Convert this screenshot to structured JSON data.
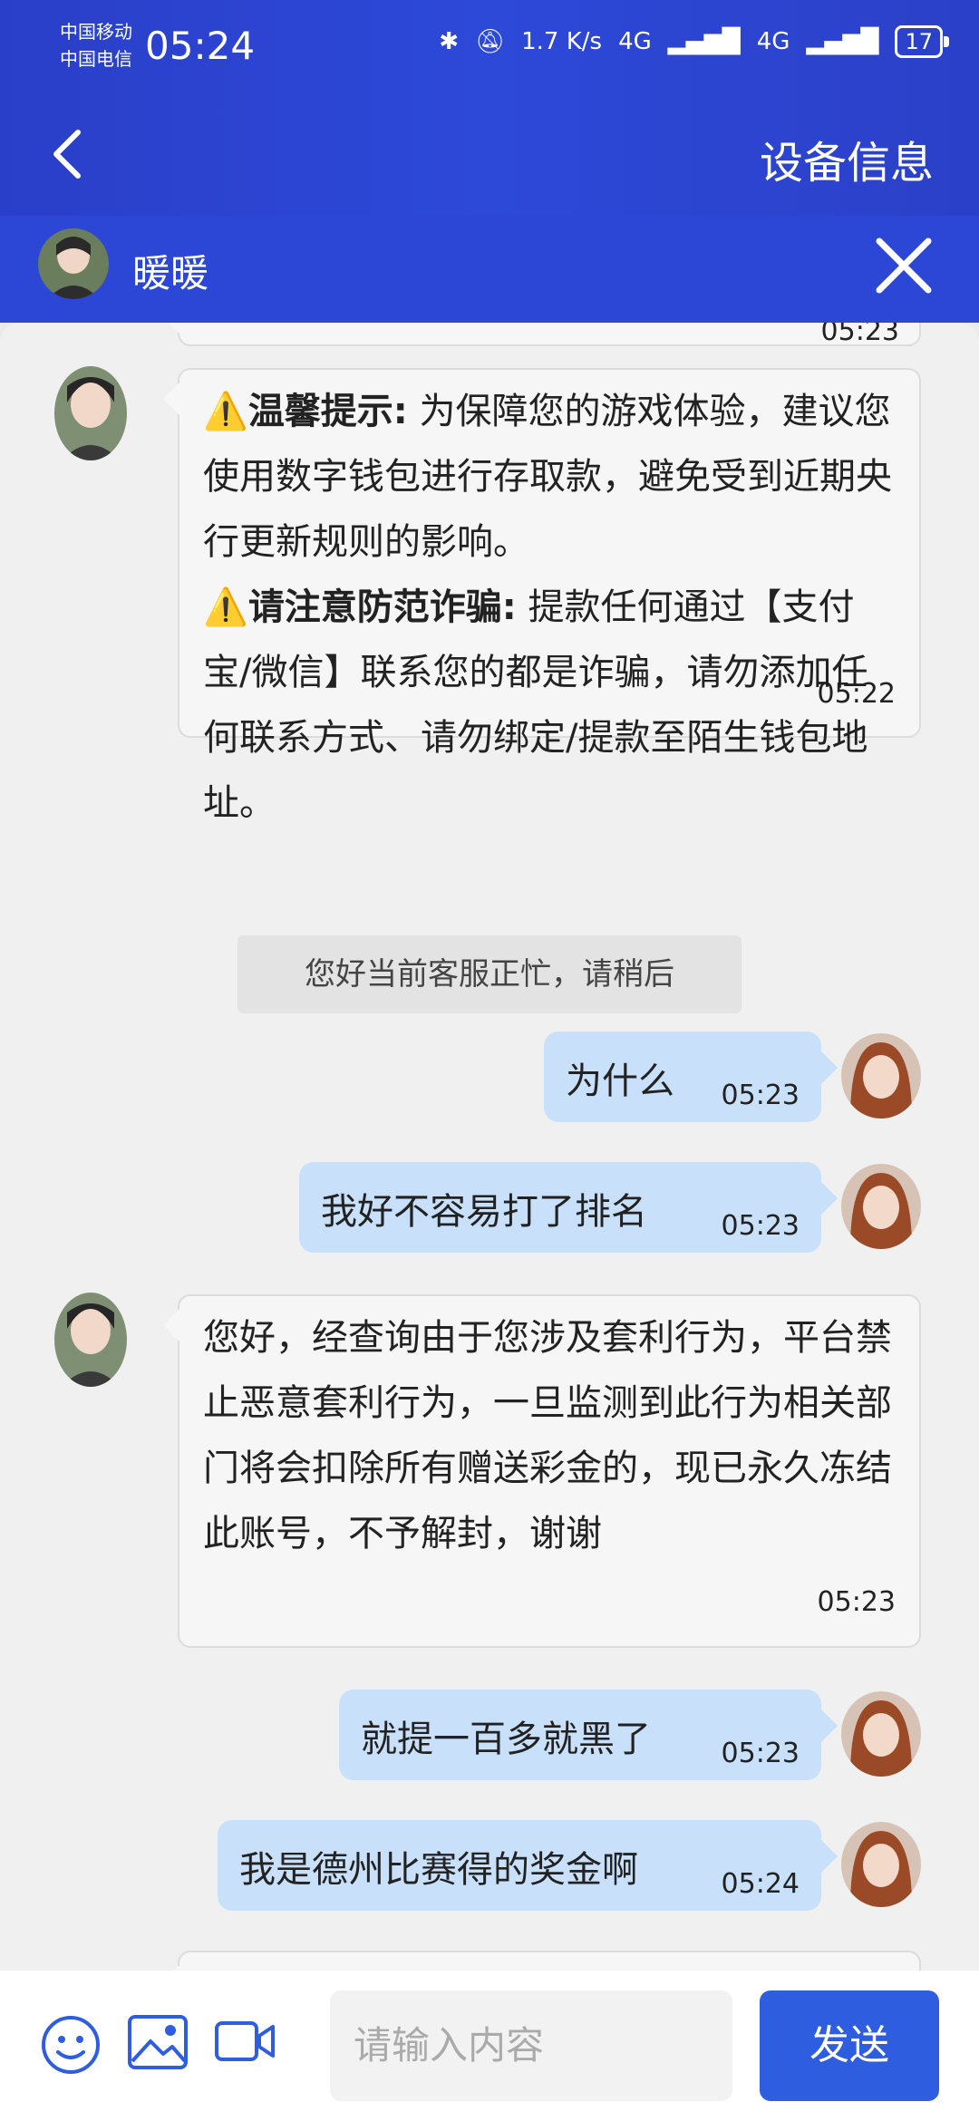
{
  "status_bar": {
    "carrier1": "中国移动",
    "carrier2": "中国电信",
    "time": "05:24",
    "net_speed": "1.7 K/s",
    "signal1": "4G",
    "signal2": "4G",
    "battery": "17"
  },
  "header": {
    "title": "设备信息"
  },
  "chat_header": {
    "name": "暖暖"
  },
  "messages": [
    {
      "from": "agent",
      "title1": "温馨提示:",
      "text1": "为保障您的游戏体验，建议您使用数字钱包进行存取款，避免受到近期央行更新规则的影响。",
      "title2": "请注意防范诈骗:",
      "text2": "提款任何通过【支付宝/微信】联系您的都是诈骗，请勿添加任何联系方式、请勿绑定/提款至陌生钱包地址。",
      "time": "05:22"
    },
    {
      "from": "system",
      "text": "您好当前客服正忙，请稍后"
    },
    {
      "from": "user",
      "text": "为什么",
      "time": "05:23"
    },
    {
      "from": "user",
      "text": "我好不容易打了排名",
      "time": "05:23"
    },
    {
      "from": "agent",
      "text": "您好，经查询由于您涉及套利行为，平台禁止恶意套利行为，一旦监测到此行为相关部门将会扣除所有赠送彩金的，现已永久冻结此账号，不予解封，谢谢",
      "time": "05:23"
    },
    {
      "from": "user",
      "text": "就提一百多就黑了",
      "time": "05:23"
    },
    {
      "from": "user",
      "text": "我是德州比赛得的奖金啊",
      "time": "05:24"
    }
  ],
  "top_partial": {
    "time": "05:23"
  },
  "composer": {
    "placeholder": "请输入内容",
    "send_label": "发送"
  },
  "colors": {
    "brand": "#2c46d6",
    "bubble_user": "#c9e0fb",
    "send": "#2f5de0"
  }
}
